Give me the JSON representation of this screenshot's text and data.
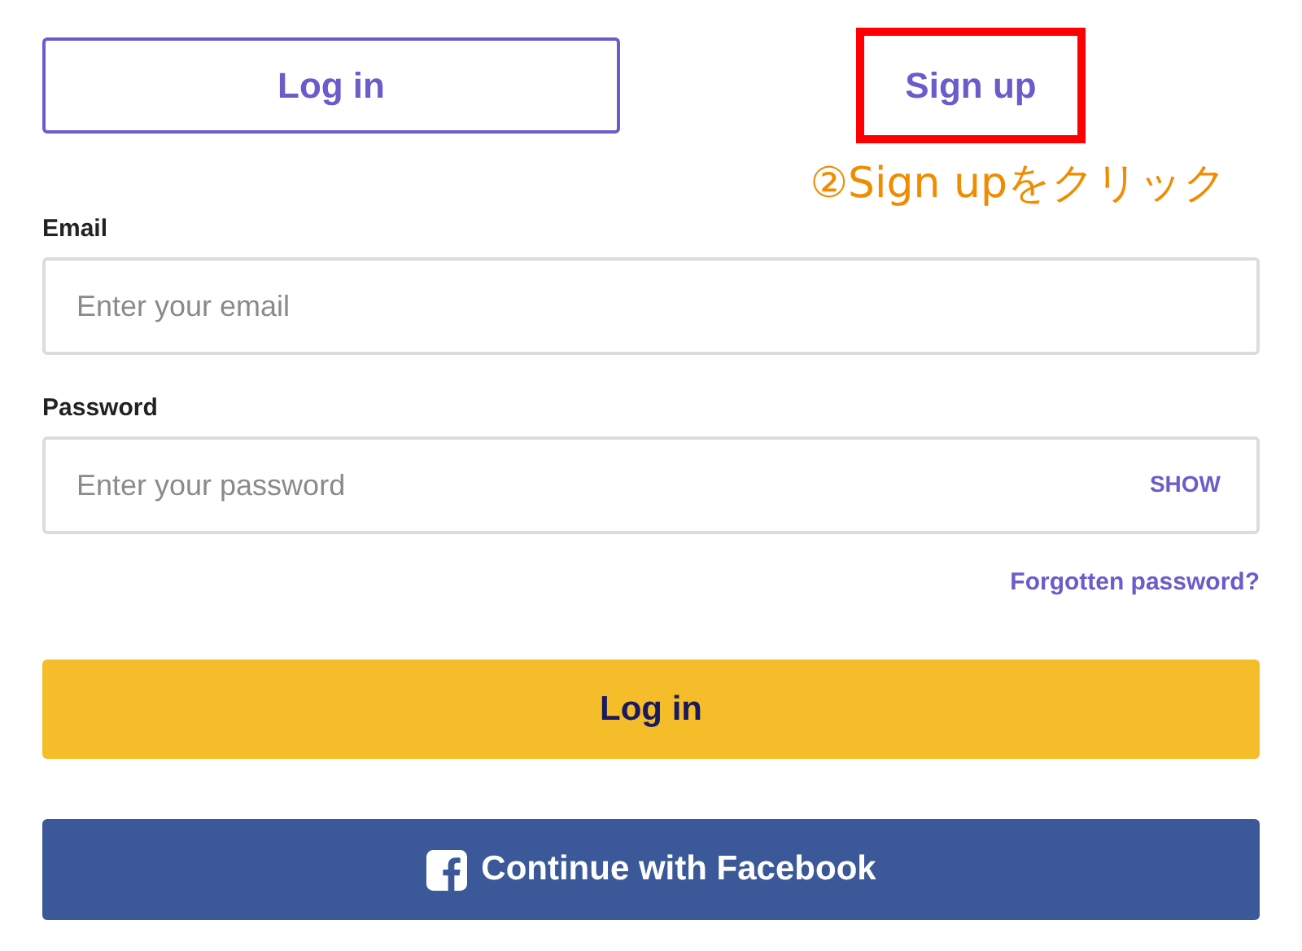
{
  "tabs": [
    {
      "label": "Log in",
      "selected": true,
      "highlighted": false
    },
    {
      "label": "Sign up",
      "selected": false,
      "highlighted": true
    }
  ],
  "annotation": {
    "note": "②Sign upをクリック"
  },
  "email": {
    "label": "Email",
    "placeholder": "Enter your email"
  },
  "password": {
    "label": "Password",
    "placeholder": "Enter your password",
    "toggle": "SHOW"
  },
  "forgot_link": "Forgotten password?",
  "login_button": "Log in",
  "facebook_button": "Continue with Facebook"
}
